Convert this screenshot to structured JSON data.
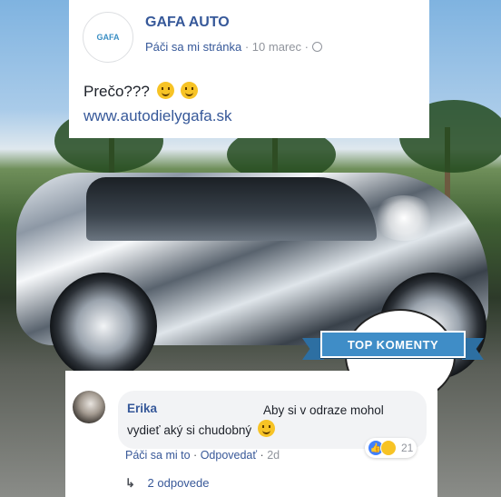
{
  "post": {
    "page_name": "GAFA AUTO",
    "avatar_text": "GAFA",
    "like_label": "Páči sa mi stránka",
    "separator": "·",
    "date": "10 marec",
    "text": "Prečo???",
    "link": "www.autodielygafa.sk"
  },
  "badge": {
    "label": "TOP KOMENTY"
  },
  "comment": {
    "author": "Erika",
    "text": "Aby si v odraze mohol vydieť aký si chudobný",
    "like_label": "Páči sa mi to",
    "reply_label": "Odpovedať",
    "time": "2d",
    "reaction_count": "21",
    "reactions": [
      "like-icon",
      "haha-icon"
    ],
    "replies_label": "2 odpovede"
  },
  "colors": {
    "link_blue": "#365899",
    "badge_blue": "#3f8dc7"
  }
}
